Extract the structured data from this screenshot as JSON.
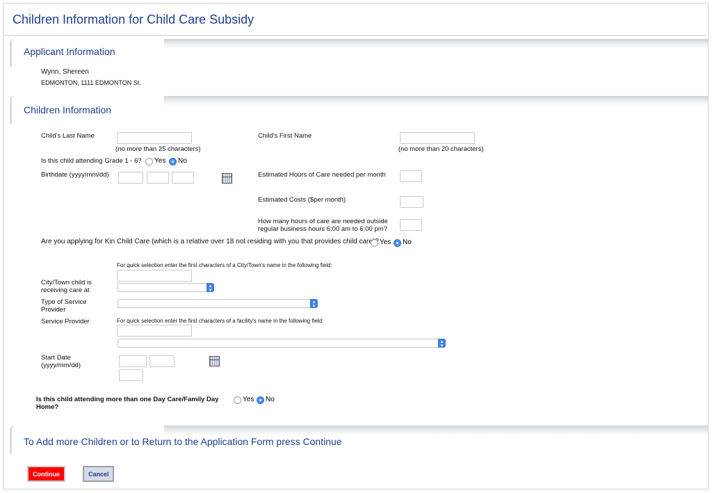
{
  "page": {
    "title": "Children Information for Child Care Subsidy"
  },
  "applicant": {
    "heading": "Applicant Information",
    "name": "Wynn, Shereen",
    "address": "EDMONTON, 1111 EDMONTON St."
  },
  "children": {
    "heading": "Children Information",
    "last_name_label": "Child's Last Name",
    "last_name_hint": "(no more than 25 characters)",
    "first_name_label": "Child's First Name",
    "first_name_hint": "(no more than 20 characters)",
    "grade_question": "Is this child attending Grade 1 - 6?",
    "birthdate_label": "Birthdate (yyyy/mm/dd)",
    "hours_label": "Estimated Hours of Care needed per month",
    "costs_label": "Estimated Costs ($per month)",
    "outside_hours_line1": "How many hours of care are needed outside",
    "outside_hours_line2": "regular business hours 6:00 am to 6:00 pm?",
    "kin_question": "Are you applying for Kin Child Care (which is a relative over 18 not residing with you that provides child care)?",
    "city_hint": "For quick selection enter the first characters of a City/Town's name in the following field:",
    "city_label_line1": "City/Town child is",
    "city_label_line2": "receiving care at",
    "provider_type_line1": "Type of Service",
    "provider_type_line2": "Provider",
    "provider_label": "Service Provider",
    "facility_hint": "For quick selection enter the first characters of a facility's name in the following field:",
    "start_date_line1": "Start Date",
    "start_date_line2": "(yyyy/mm/dd)",
    "multi_daycare_line1": "Is this child attending more than one Day Care/Family Day",
    "multi_daycare_line2": "Home?"
  },
  "options": {
    "yes": "Yes",
    "no": "No"
  },
  "answers": {
    "grade": "No",
    "kin": "No",
    "multi_daycare": "No"
  },
  "footer": {
    "heading": "To Add more Children or to Return to the Application Form press Continue",
    "continue_label": "Continue",
    "cancel_label": "Cancel"
  },
  "icons": {
    "calendar": "calendar-icon",
    "select_arrow": "select-arrow-icon"
  },
  "colors": {
    "heading": "#1d3f8f",
    "continue_bg": "#ff0000",
    "radio_selected": "#4a90f0"
  }
}
